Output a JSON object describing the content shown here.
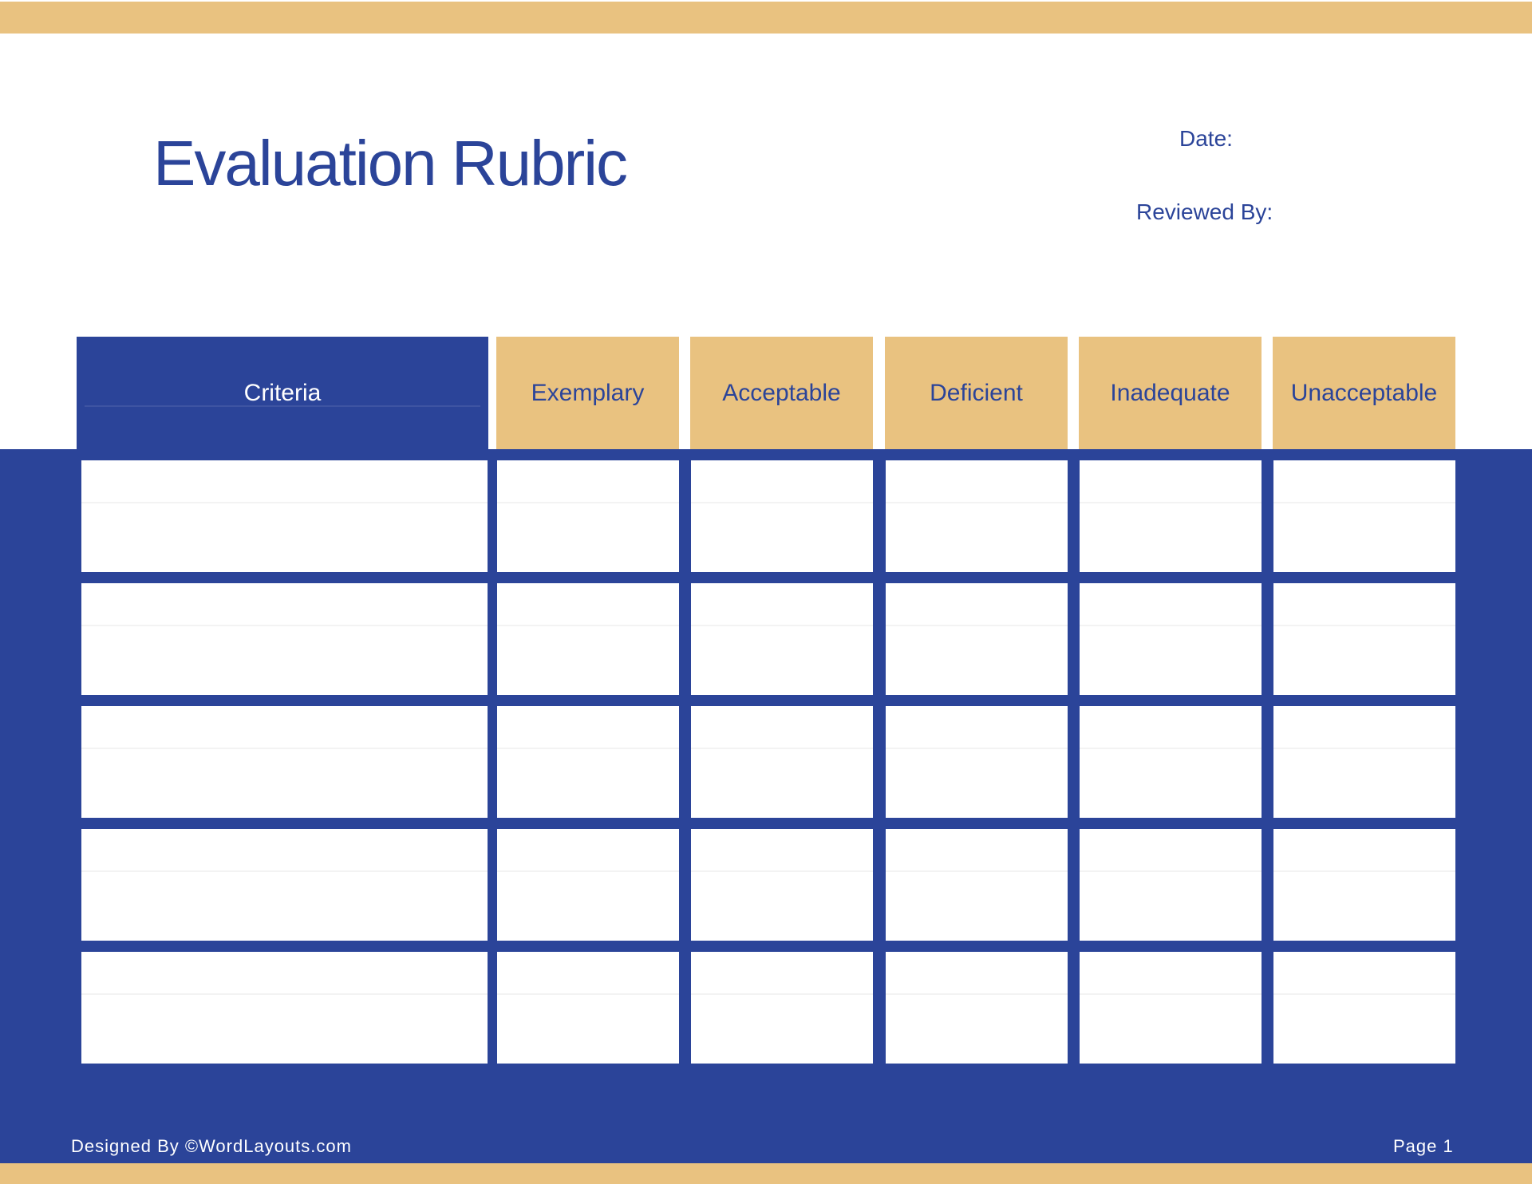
{
  "page": {
    "title": "Evaluation Rubric",
    "date_label": "Date:",
    "reviewed_by_label": "Reviewed By:",
    "footer_credit": "Designed By ©WordLayouts.com",
    "page_number": "Page 1"
  },
  "table": {
    "criteria_header": "Criteria",
    "rating_headers": [
      "Exemplary",
      "Acceptable",
      "Deficient",
      "Inadequate",
      "Unacceptable"
    ],
    "row_count": 5,
    "rows": [
      {
        "criteria": "",
        "ratings": [
          "",
          "",
          "",
          "",
          ""
        ]
      },
      {
        "criteria": "",
        "ratings": [
          "",
          "",
          "",
          "",
          ""
        ]
      },
      {
        "criteria": "",
        "ratings": [
          "",
          "",
          "",
          "",
          ""
        ]
      },
      {
        "criteria": "",
        "ratings": [
          "",
          "",
          "",
          "",
          ""
        ]
      },
      {
        "criteria": "",
        "ratings": [
          "",
          "",
          "",
          "",
          ""
        ]
      }
    ]
  },
  "colors": {
    "accent_blue": "#2B4499",
    "accent_tan": "#E9C280",
    "header_text_on_blue": "#FFFFFF",
    "header_text_on_tan": "#2B4499",
    "footer_text": "#FFFFFF"
  }
}
